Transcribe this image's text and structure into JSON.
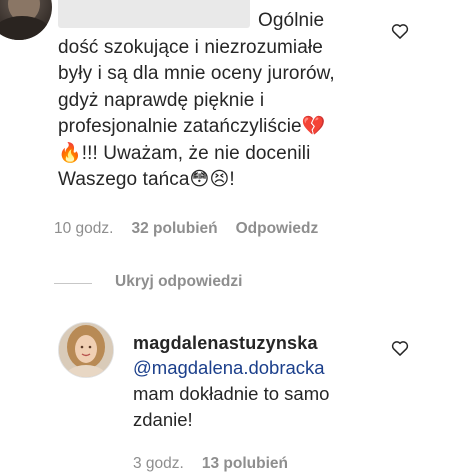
{
  "comment": {
    "text_line1": "Ogólnie",
    "text_rest": "dość szokujące i niezrozumiałe\nbyły i są dla mnie oceny jurorów,\ngdyż naprawdę pięknie i\nprofesjonalnie zatańczyliście💔\n🔥!!! Uważam, że nie docenili\nWaszego tańca😳😣!",
    "time": "10 godz.",
    "likes": "32 polubień",
    "reply_label": "Odpowiedz",
    "liked": false
  },
  "hide_replies_label": "Ukryj odpowiedzi",
  "reply": {
    "username": "magdalenastuzynska",
    "mention": "@magdalena.dobracka",
    "text": "mam dokładnie to samo\nzdanie!",
    "time": "3 godz.",
    "likes": "13 polubień"
  },
  "colors": {
    "text": "#262626",
    "secondary": "#8e8e8e",
    "mention": "#1b3f8b",
    "redaction": "#e9e9e9"
  },
  "icons": {
    "like": "heart-outline-icon"
  }
}
